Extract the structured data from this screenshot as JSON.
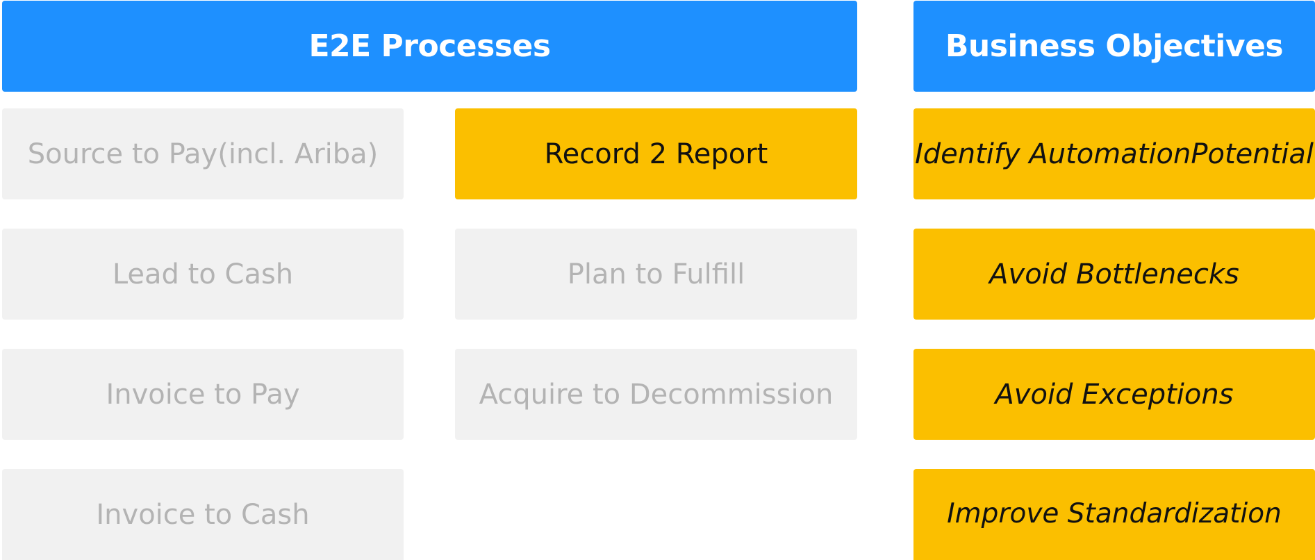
{
  "headers": {
    "processes": "E2E Processes",
    "objectives": "Business Objectives"
  },
  "processes": {
    "source_to_pay": {
      "line1": "Source to Pay",
      "line2": "(incl. Ariba)"
    },
    "record_to_report": "Record 2 Report",
    "lead_to_cash": "Lead to Cash",
    "plan_to_fulfill": "Plan to Fulfill",
    "invoice_to_pay": "Invoice to Pay",
    "acquire_to_decommission": "Acquire to Decommission",
    "invoice_to_cash": "Invoice to Cash"
  },
  "objectives": {
    "automation": {
      "line1": "Identify Automation",
      "line2": "Potential"
    },
    "bottlenecks": "Avoid Bottlenecks",
    "exceptions": "Avoid Exceptions",
    "standardization": "Improve Standardization"
  },
  "colors": {
    "header_blue": "#1e90ff",
    "highlight_yellow": "#fbbf00",
    "inactive_gray": "#f1f1f1",
    "inactive_text": "#b3b3b3"
  }
}
